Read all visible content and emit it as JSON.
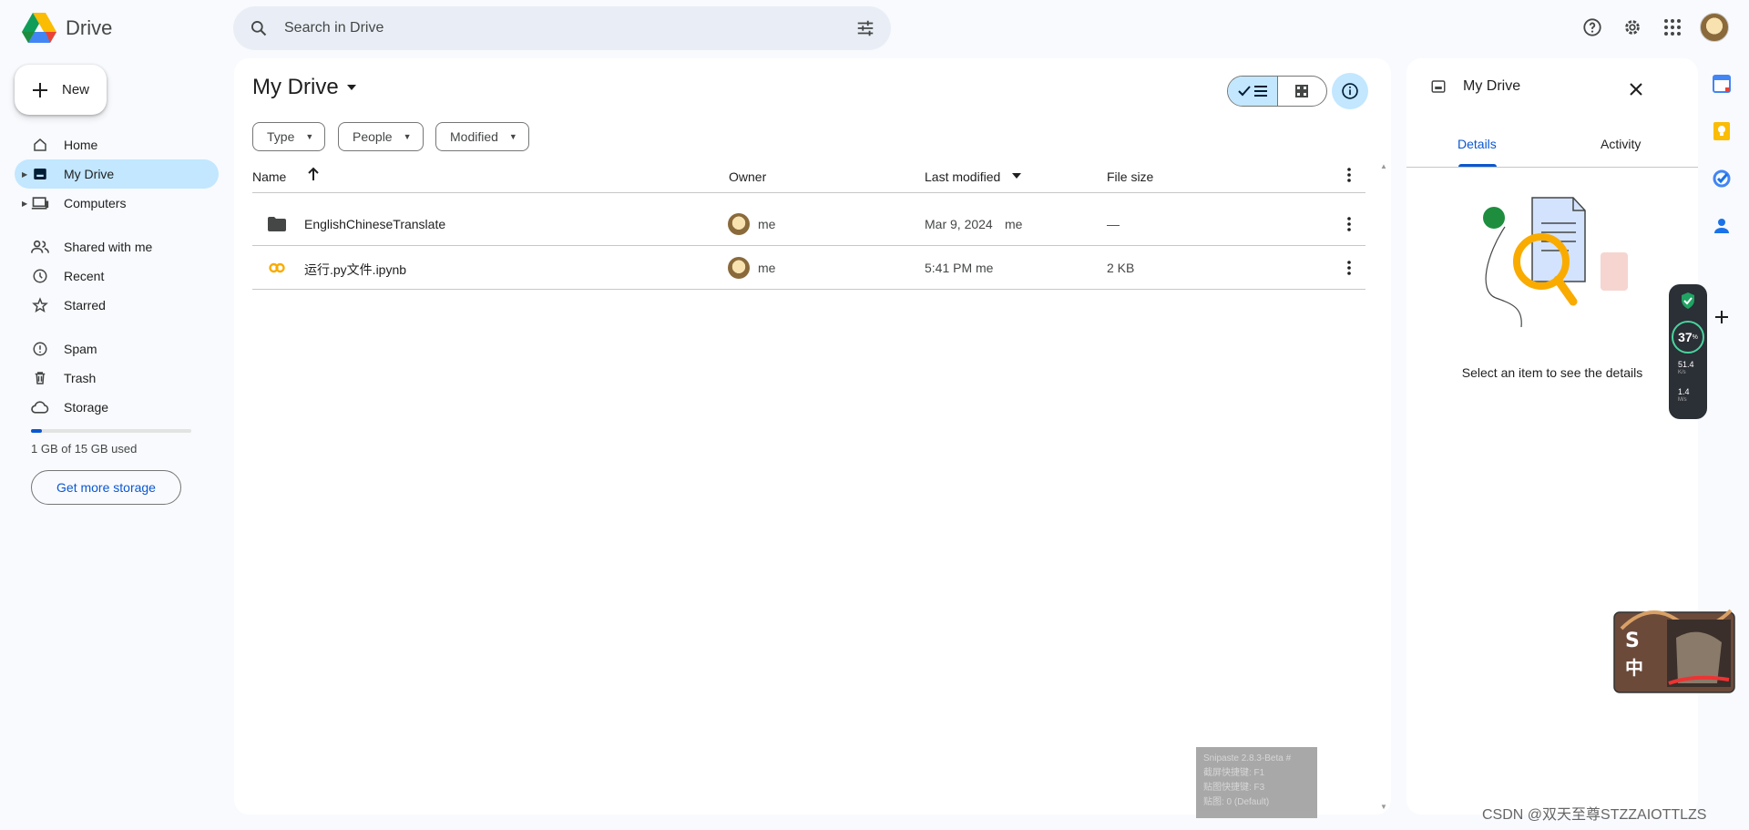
{
  "header": {
    "app_name": "Drive",
    "search_placeholder": "Search in Drive"
  },
  "sidebar": {
    "new_label": "New",
    "items": [
      {
        "label": "Home",
        "icon": "home-icon"
      },
      {
        "label": "My Drive",
        "icon": "my-drive-icon",
        "active": true
      },
      {
        "label": "Computers",
        "icon": "computer-icon"
      },
      {
        "label": "Shared with me",
        "icon": "people-icon"
      },
      {
        "label": "Recent",
        "icon": "clock-icon"
      },
      {
        "label": "Starred",
        "icon": "star-icon"
      },
      {
        "label": "Spam",
        "icon": "spam-icon"
      },
      {
        "label": "Trash",
        "icon": "trash-icon"
      },
      {
        "label": "Storage",
        "icon": "cloud-icon"
      }
    ],
    "storage_used_fraction": 0.067,
    "storage_text": "1 GB of 15 GB used",
    "storage_button": "Get more storage"
  },
  "main": {
    "title": "My Drive",
    "filters": [
      "Type",
      "People",
      "Modified"
    ],
    "columns": {
      "name": "Name",
      "owner": "Owner",
      "modified": "Last modified",
      "size": "File size"
    },
    "rows": [
      {
        "name": "EnglishChineseTranslate",
        "type": "folder",
        "owner": "me",
        "modified": "Mar 9, 2024",
        "modified_by": "me",
        "size": "—"
      },
      {
        "name": "运行.py文件.ipynb",
        "type": "colab",
        "owner": "me",
        "modified": "5:41 PM",
        "modified_by": "me",
        "size": "2 KB"
      }
    ]
  },
  "details": {
    "title": "My Drive",
    "tab_details": "Details",
    "tab_activity": "Activity",
    "empty_text": "Select an item to see the details"
  },
  "overlay": {
    "meter_pct": "37",
    "meter_pct_unit": "%",
    "up_speed": "51.4",
    "up_unit": "K/s",
    "down_speed": "1.4",
    "down_unit": "M/s",
    "snip_lines": [
      "Snipaste 2.8.3-Beta #",
      "截屏快捷键: F1",
      "贴图快捷键: F3",
      "贴图: 0 (Default)"
    ],
    "watermark": "CSDN @双天至尊STZZAIOTTLZS"
  },
  "colors": {
    "accent": "#0b57d0",
    "selected": "#c2e7ff",
    "bg": "#f8fafd"
  }
}
